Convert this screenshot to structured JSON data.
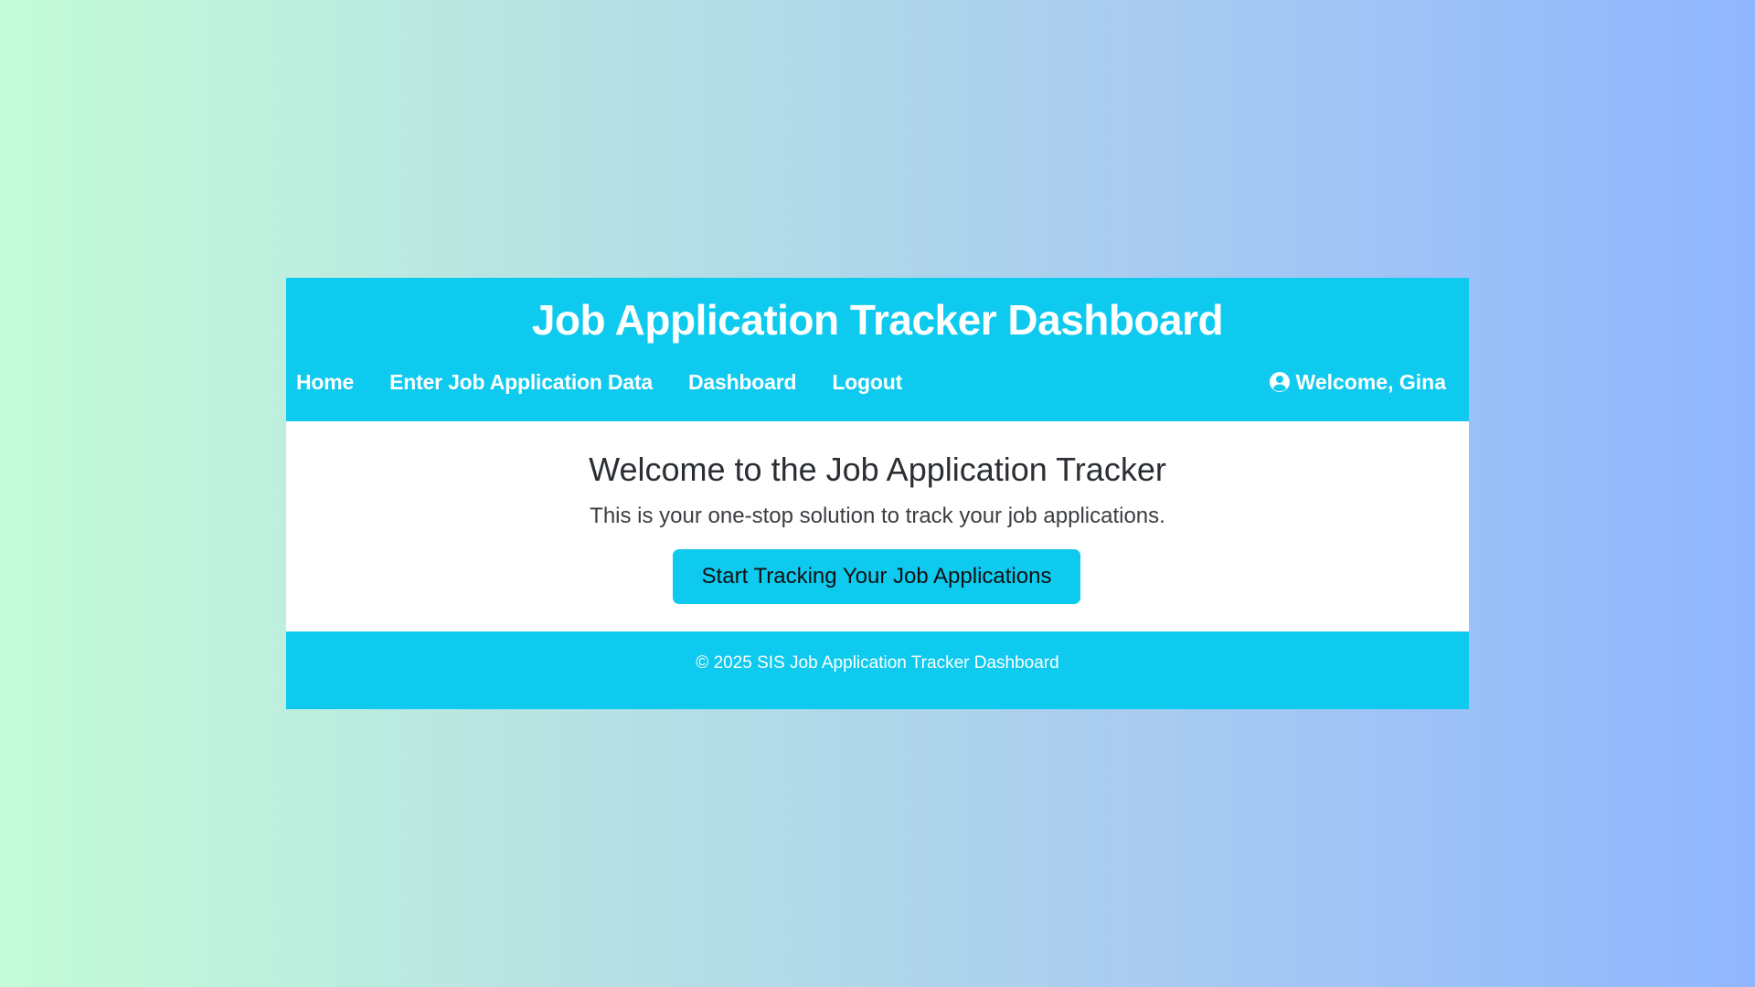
{
  "header": {
    "title": "Job Application Tracker Dashboard"
  },
  "nav": {
    "items": [
      {
        "label": "Home"
      },
      {
        "label": "Enter Job Application Data"
      },
      {
        "label": "Dashboard"
      },
      {
        "label": "Logout"
      }
    ],
    "user": {
      "icon": "user-circle-icon",
      "welcome_text": "Welcome, Gina"
    }
  },
  "main": {
    "heading": "Welcome to the Job Application Tracker",
    "subtitle": "This is your one-stop solution to track your job applications.",
    "cta_label": "Start Tracking Your Job Applications"
  },
  "footer": {
    "text": "© 2025 SIS Job Application Tracker Dashboard"
  },
  "colors": {
    "accent": "#0ecaee",
    "background_gradient_start": "#c4fcd8",
    "background_gradient_end": "#90b6ff"
  }
}
